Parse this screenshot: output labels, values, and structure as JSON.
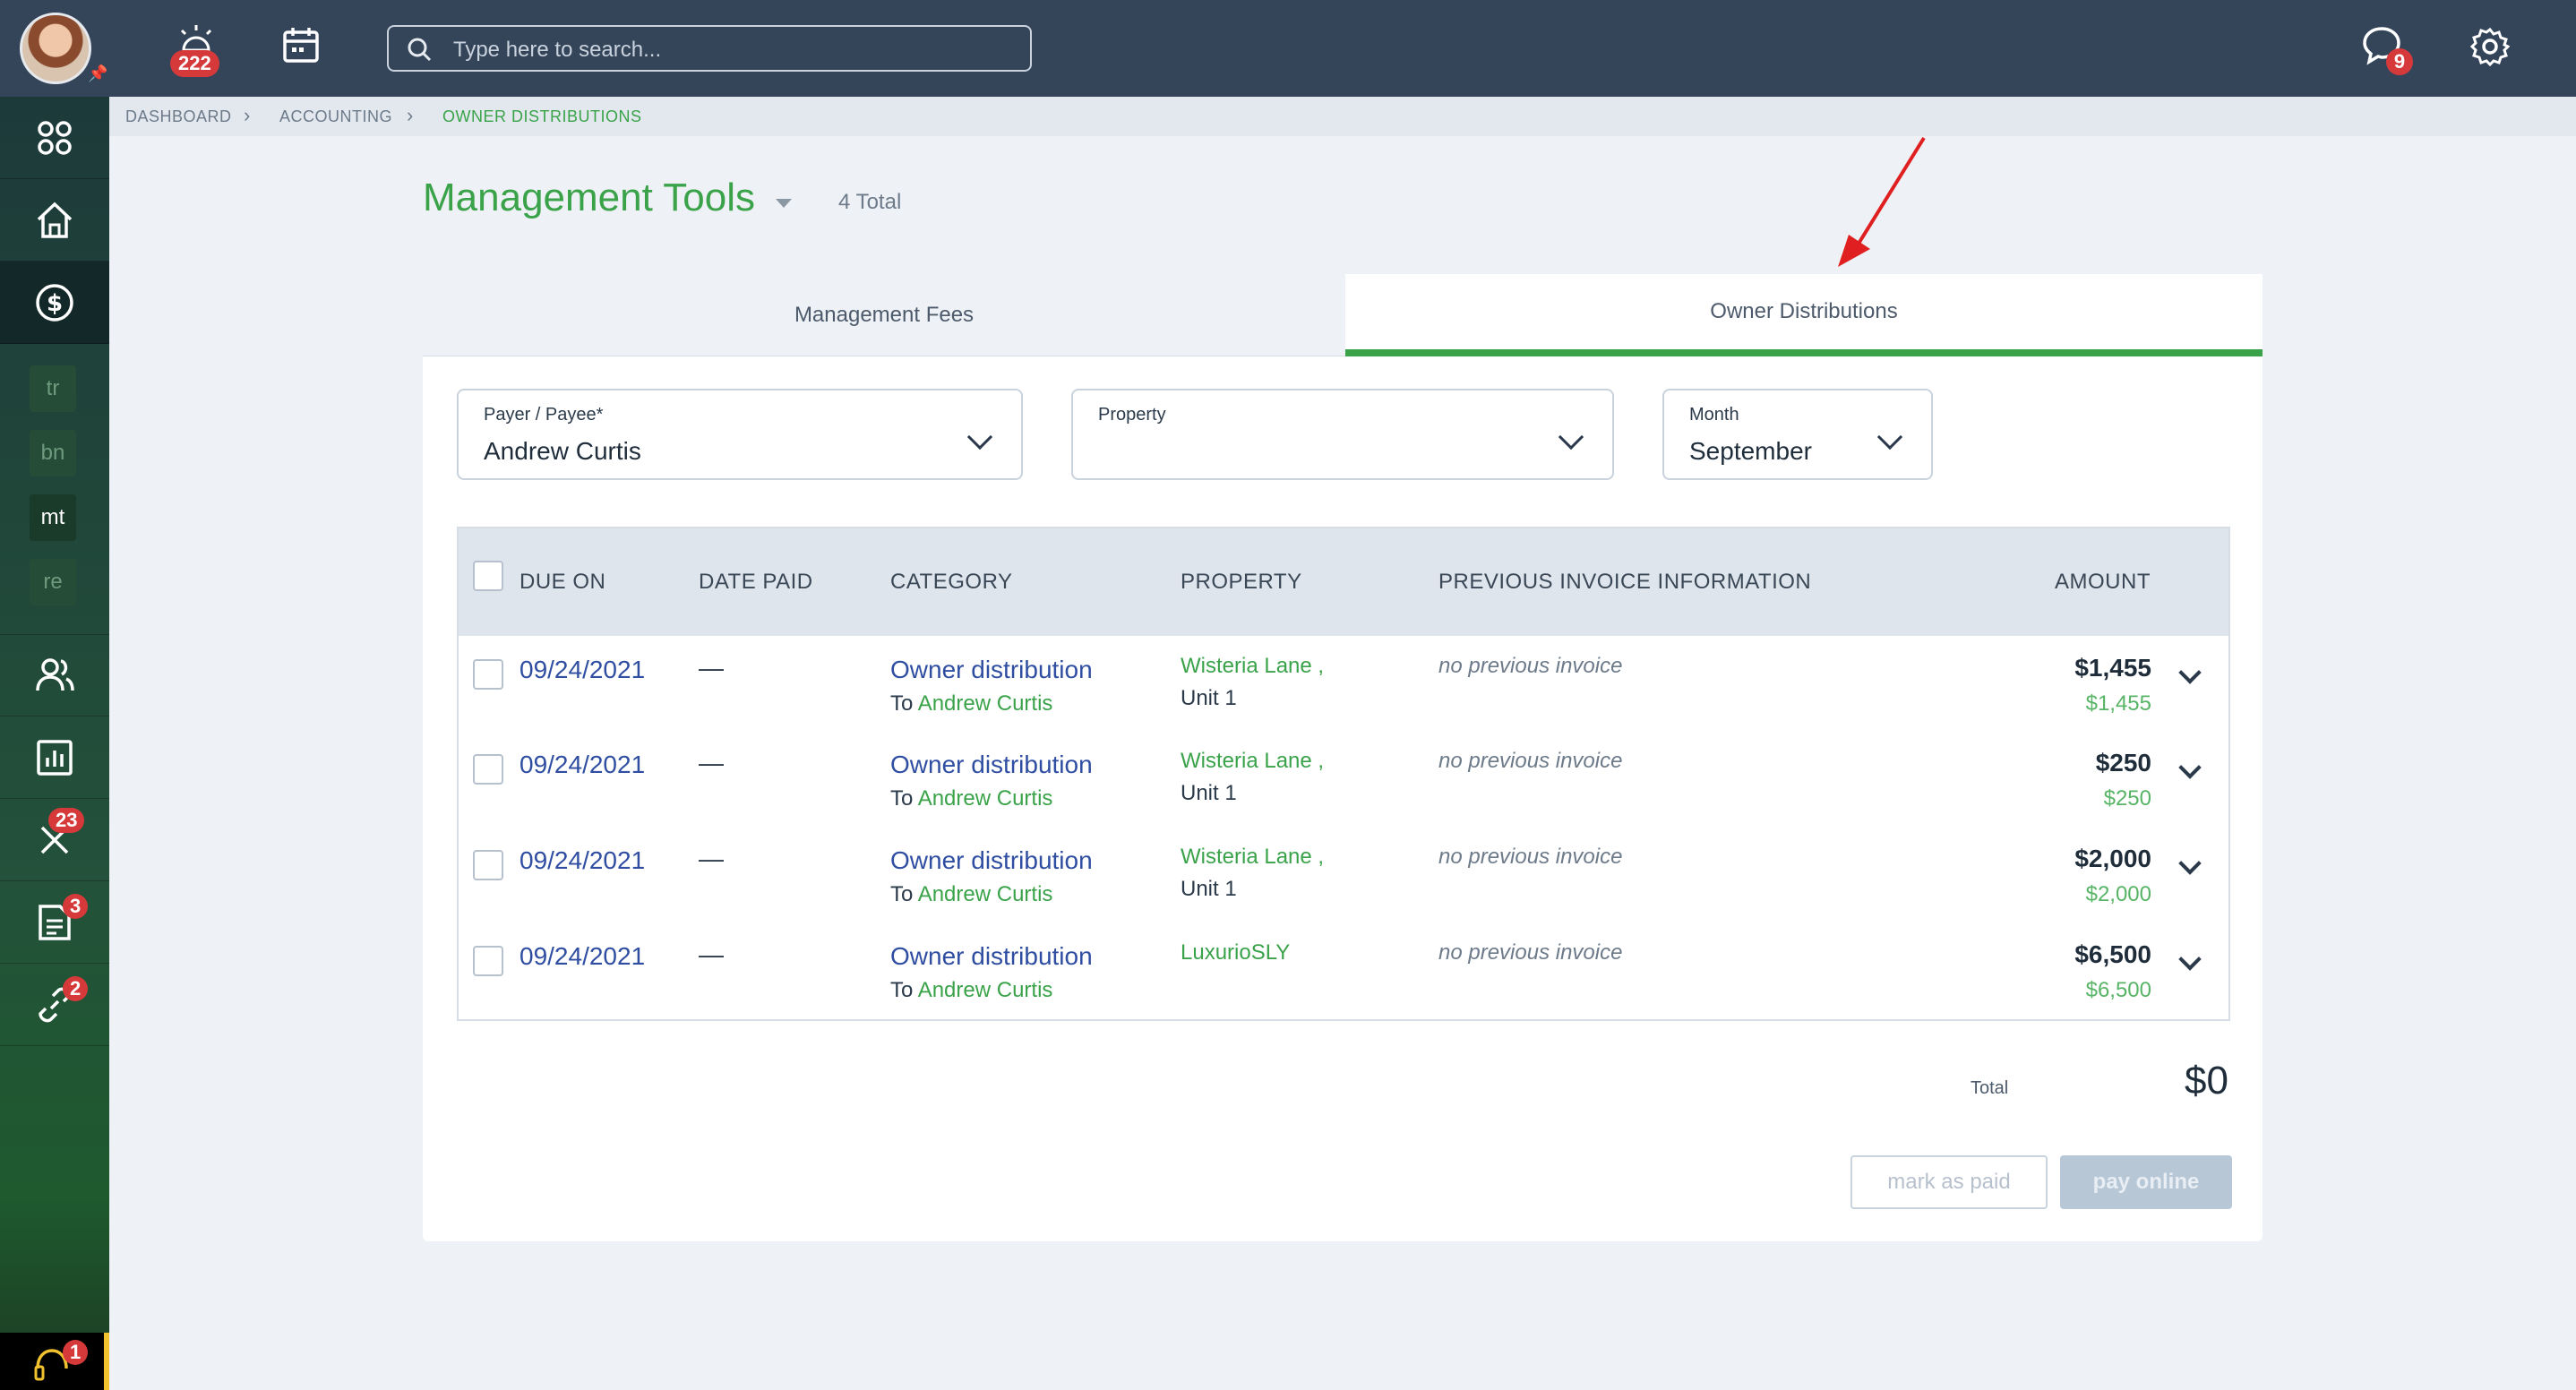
{
  "topbar": {
    "alerts_badge": "222",
    "messages_badge": "9",
    "search_placeholder": "Type here to search..."
  },
  "sidebar": {
    "shortcuts": [
      "tr",
      "bn",
      "mt",
      "re"
    ],
    "badges": {
      "tools": "23",
      "documents": "3",
      "links": "2",
      "support": "1"
    }
  },
  "breadcrumb": [
    "DASHBOARD",
    "ACCOUNTING",
    "OWNER DISTRIBUTIONS"
  ],
  "header": {
    "title": "Management Tools",
    "total": "4 Total"
  },
  "tabs": [
    "Management Fees",
    "Owner Distributions"
  ],
  "filters": {
    "payer": {
      "label": "Payer / Payee*",
      "value": "Andrew Curtis"
    },
    "property": {
      "label": "Property",
      "value": ""
    },
    "month": {
      "label": "Month",
      "value": "September"
    }
  },
  "table": {
    "columns": [
      "DUE ON",
      "DATE PAID",
      "CATEGORY",
      "PROPERTY",
      "PREVIOUS INVOICE INFORMATION",
      "AMOUNT"
    ],
    "rows": [
      {
        "due": "09/24/2021",
        "paid": "—",
        "category": "Owner distribution",
        "to_prefix": "To",
        "to": "Andrew Curtis",
        "property": "Wisteria Lane ,",
        "unit": "Unit 1",
        "previous": "no previous invoice",
        "amount": "$1,455",
        "amount_sub": "$1,455"
      },
      {
        "due": "09/24/2021",
        "paid": "—",
        "category": "Owner distribution",
        "to_prefix": "To",
        "to": "Andrew Curtis",
        "property": "Wisteria Lane ,",
        "unit": "Unit 1",
        "previous": "no previous invoice",
        "amount": "$250",
        "amount_sub": "$250"
      },
      {
        "due": "09/24/2021",
        "paid": "—",
        "category": "Owner distribution",
        "to_prefix": "To",
        "to": "Andrew Curtis",
        "property": "Wisteria Lane ,",
        "unit": "Unit 1",
        "previous": "no previous invoice",
        "amount": "$2,000",
        "amount_sub": "$2,000"
      },
      {
        "due": "09/24/2021",
        "paid": "—",
        "category": "Owner distribution",
        "to_prefix": "To",
        "to": "Andrew Curtis",
        "property": "LuxurioSLY",
        "unit": "",
        "previous": "no previous invoice",
        "amount": "$6,500",
        "amount_sub": "$6,500"
      }
    ]
  },
  "summary": {
    "total_label": "Total",
    "total_value": "$0"
  },
  "actions": {
    "mark_paid": "mark as paid",
    "pay_online": "pay online"
  },
  "colors": {
    "brand_green": "#3aa34a",
    "link_blue": "#2f4ea2",
    "topbar": "#34455a",
    "badge_red": "#d6393a",
    "annotation_arrow": "#e02020"
  }
}
